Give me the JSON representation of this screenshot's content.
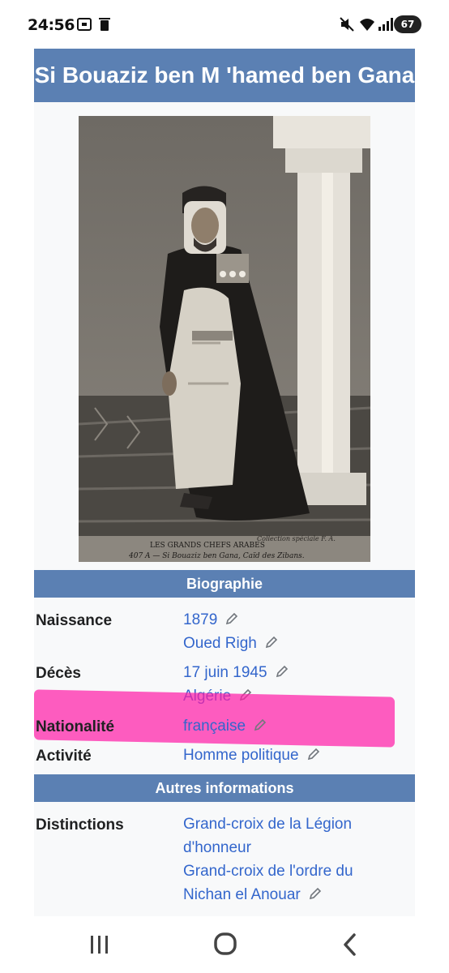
{
  "status_bar": {
    "time": "24:56",
    "battery": "67",
    "icons": [
      "screenshot-icon",
      "trash-icon",
      "mute-icon",
      "wifi-icon",
      "signal-icon"
    ]
  },
  "infobox": {
    "title": "Si Bouaziz ben M 'hamed ben Gana",
    "photo_caption_line1": "LES GRANDS CHEFS ARABES",
    "photo_caption_line2": "407 A — Si Bouaziz ben Gana, Caïd des Zibans.",
    "photo_collection": "Collection spéciale F. A.",
    "sections": {
      "biographie": "Biographie",
      "autres": "Autres informations"
    },
    "rows": {
      "naissance": {
        "label": "Naissance",
        "values": [
          "1879",
          "Oued Righ"
        ]
      },
      "deces": {
        "label": "Décès",
        "values": [
          "17 juin 1945",
          "Algérie"
        ]
      },
      "nationalite": {
        "label": "Nationalité",
        "values": [
          "française"
        ]
      },
      "activite": {
        "label": "Activité",
        "values": [
          "Homme politique"
        ]
      },
      "distinctions": {
        "label": "Distinctions",
        "values": [
          "Grand-croix de la Légion",
          "d'honneur",
          "Grand-croix de l'ordre du",
          "Nichan el Anouar"
        ]
      }
    }
  },
  "colors": {
    "header_blue": "#5b80b3",
    "link_blue": "#3366cc",
    "highlight_pink": "#ff1fa8",
    "box_bg": "#f8f9fa"
  },
  "nav_bar": {
    "icons": [
      "recent-apps-icon",
      "home-icon",
      "back-icon"
    ]
  }
}
